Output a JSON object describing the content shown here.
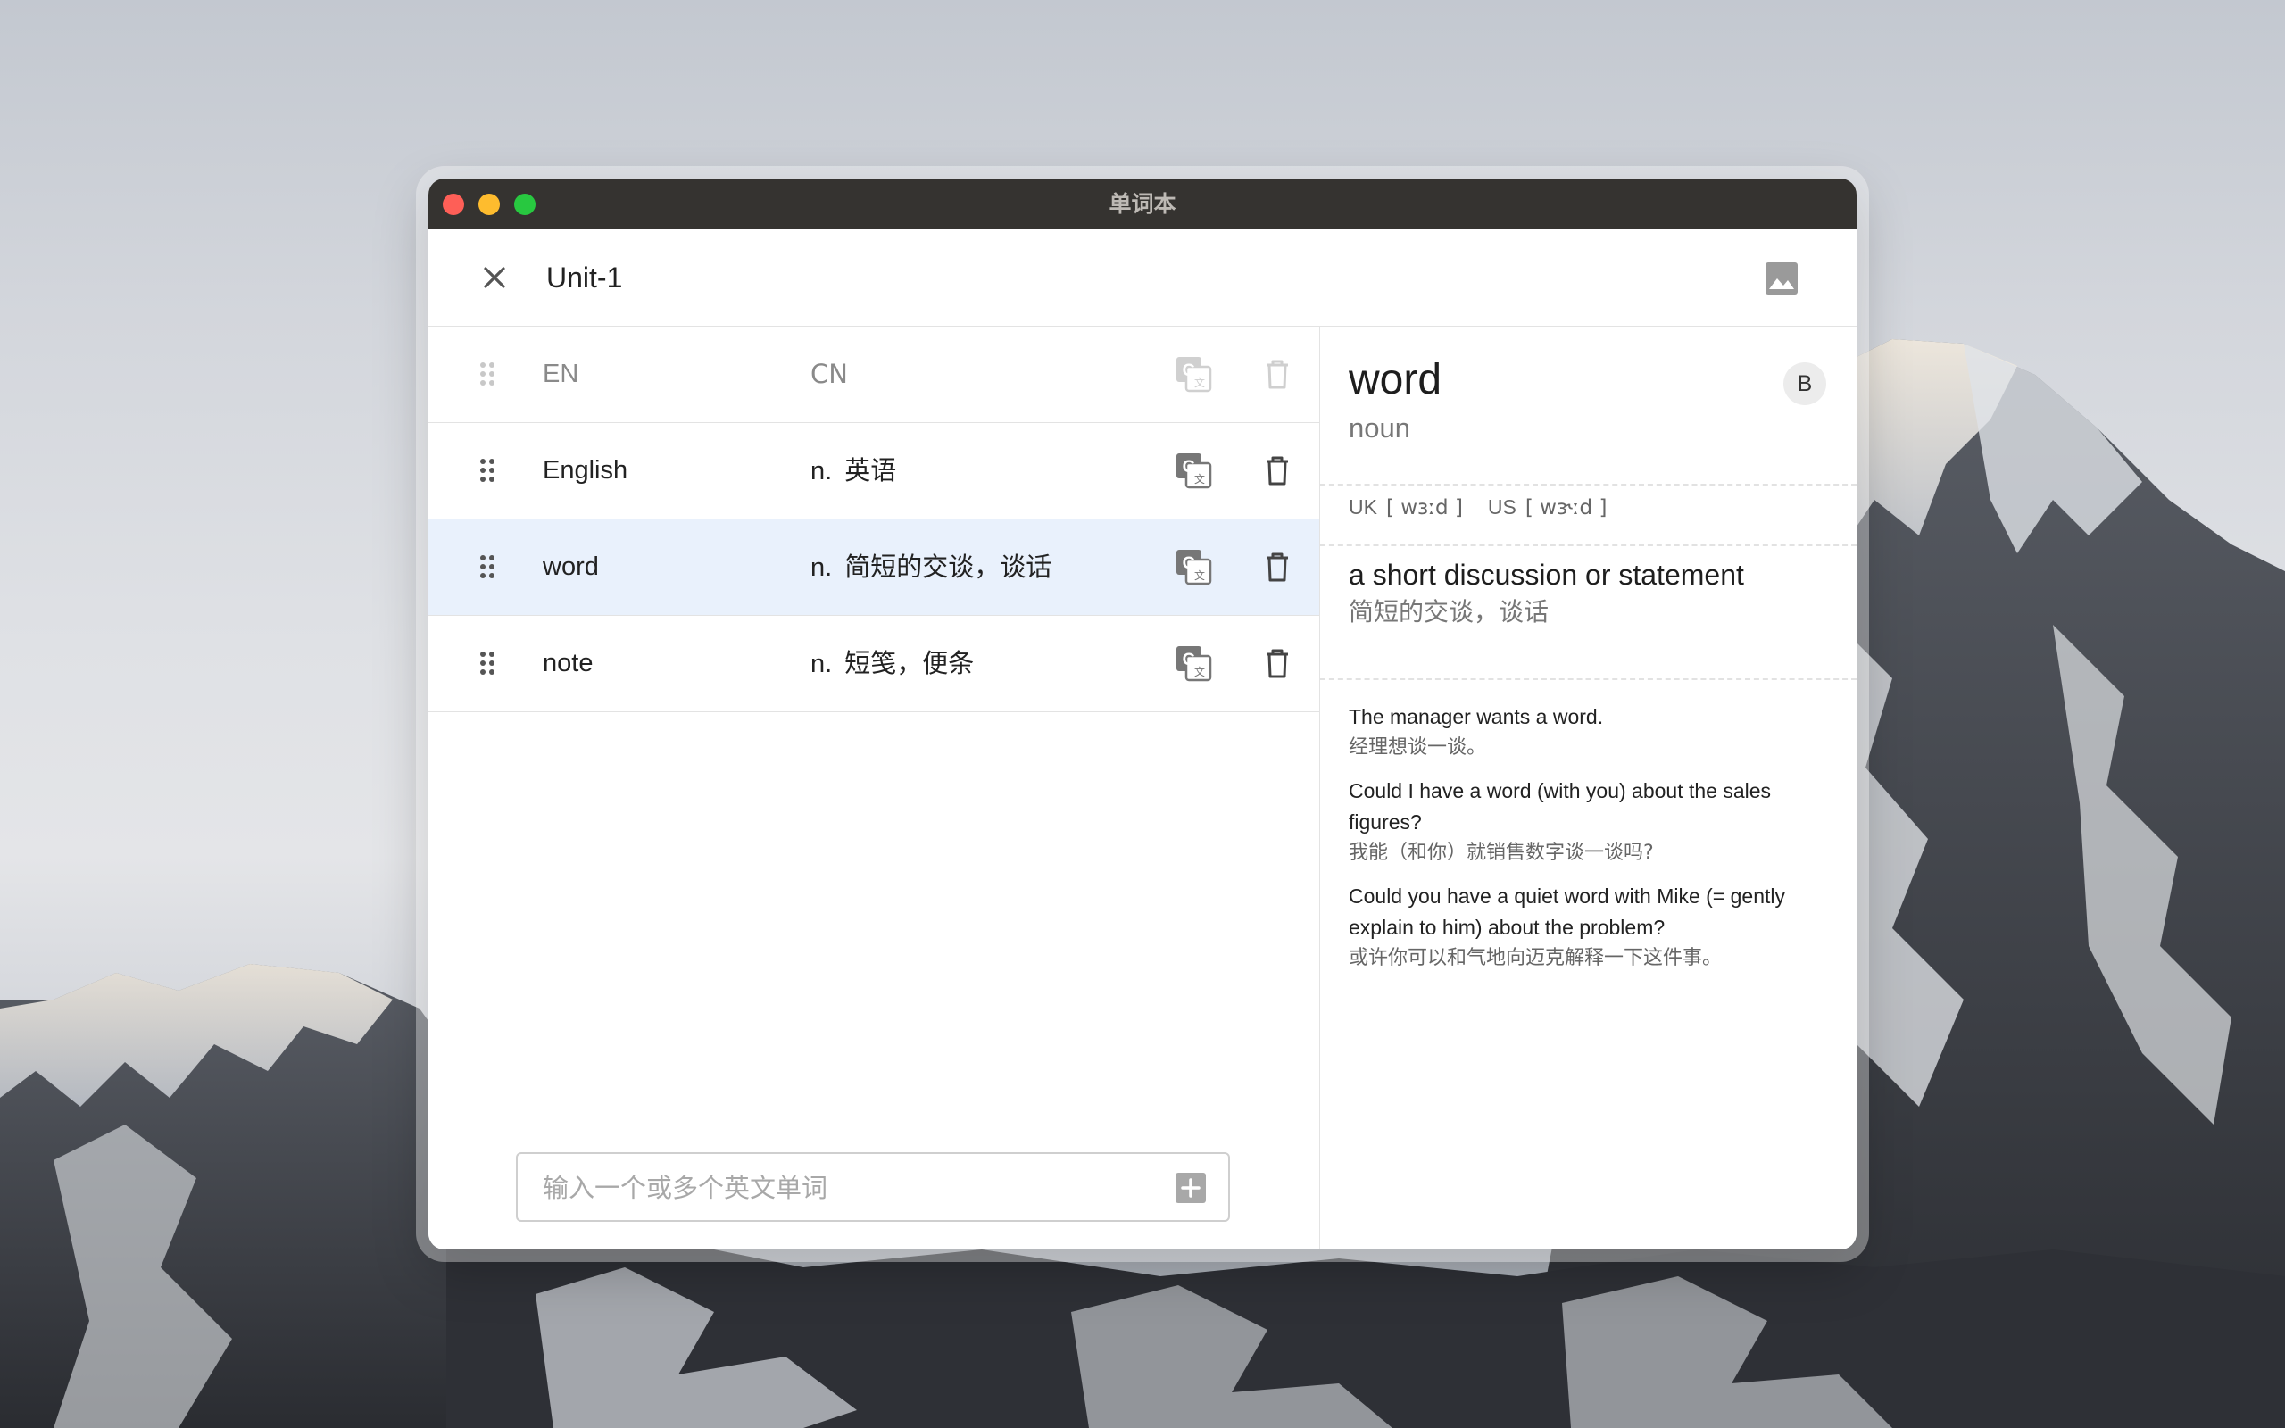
{
  "window": {
    "title": "单词本"
  },
  "header": {
    "unit_title": "Unit-1",
    "close_icon": "close-icon",
    "image_icon": "image-icon"
  },
  "table": {
    "header": {
      "en": "EN",
      "cn": "CN"
    },
    "rows": [
      {
        "en": "English",
        "pos": "n.",
        "cn": "英语",
        "selected": false
      },
      {
        "en": "word",
        "pos": "n.",
        "cn": "简短的交谈，谈话",
        "selected": true
      },
      {
        "en": "note",
        "pos": "n.",
        "cn": "短笺，便条",
        "selected": false
      }
    ]
  },
  "input": {
    "placeholder": "输入一个或多个英文单词",
    "value": ""
  },
  "detail": {
    "word": "word",
    "part_of_speech": "noun",
    "level_badge": "B",
    "uk_label": "UK",
    "uk_phonetic": "[ wɜːd ]",
    "us_label": "US",
    "us_phonetic": "[ wɝːd ]",
    "definition_en": "a short discussion or statement",
    "definition_cn": "简短的交谈，谈话",
    "examples": [
      {
        "en": "The manager wants a word.",
        "cn": "经理想谈一谈。"
      },
      {
        "en": "Could I have a word (with you) about the sales figures?",
        "cn": "我能（和你）就销售数字谈一谈吗?"
      },
      {
        "en": "Could you have a quiet word with Mike (= gently explain to him) about the problem?",
        "cn": "或许你可以和气地向迈克解释一下这件事。"
      }
    ]
  },
  "colors": {
    "selected_row": "#e9f1fc",
    "titlebar": "#353330",
    "traffic_red": "#fe5f57",
    "traffic_yellow": "#febc2e",
    "traffic_green": "#28c840"
  }
}
